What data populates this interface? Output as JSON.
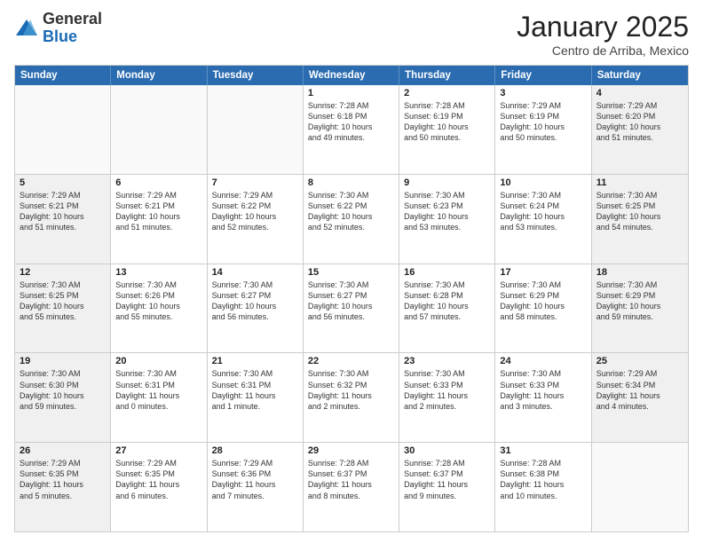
{
  "header": {
    "logo_general": "General",
    "logo_blue": "Blue",
    "month_title": "January 2025",
    "subtitle": "Centro de Arriba, Mexico"
  },
  "days_of_week": [
    "Sunday",
    "Monday",
    "Tuesday",
    "Wednesday",
    "Thursday",
    "Friday",
    "Saturday"
  ],
  "rows": [
    [
      {
        "day": "",
        "empty": true
      },
      {
        "day": "",
        "empty": true
      },
      {
        "day": "",
        "empty": true
      },
      {
        "day": "1",
        "lines": [
          "Sunrise: 7:28 AM",
          "Sunset: 6:18 PM",
          "Daylight: 10 hours",
          "and 49 minutes."
        ]
      },
      {
        "day": "2",
        "lines": [
          "Sunrise: 7:28 AM",
          "Sunset: 6:19 PM",
          "Daylight: 10 hours",
          "and 50 minutes."
        ]
      },
      {
        "day": "3",
        "lines": [
          "Sunrise: 7:29 AM",
          "Sunset: 6:19 PM",
          "Daylight: 10 hours",
          "and 50 minutes."
        ]
      },
      {
        "day": "4",
        "shaded": true,
        "lines": [
          "Sunrise: 7:29 AM",
          "Sunset: 6:20 PM",
          "Daylight: 10 hours",
          "and 51 minutes."
        ]
      }
    ],
    [
      {
        "day": "5",
        "shaded": true,
        "lines": [
          "Sunrise: 7:29 AM",
          "Sunset: 6:21 PM",
          "Daylight: 10 hours",
          "and 51 minutes."
        ]
      },
      {
        "day": "6",
        "lines": [
          "Sunrise: 7:29 AM",
          "Sunset: 6:21 PM",
          "Daylight: 10 hours",
          "and 51 minutes."
        ]
      },
      {
        "day": "7",
        "lines": [
          "Sunrise: 7:29 AM",
          "Sunset: 6:22 PM",
          "Daylight: 10 hours",
          "and 52 minutes."
        ]
      },
      {
        "day": "8",
        "lines": [
          "Sunrise: 7:30 AM",
          "Sunset: 6:22 PM",
          "Daylight: 10 hours",
          "and 52 minutes."
        ]
      },
      {
        "day": "9",
        "lines": [
          "Sunrise: 7:30 AM",
          "Sunset: 6:23 PM",
          "Daylight: 10 hours",
          "and 53 minutes."
        ]
      },
      {
        "day": "10",
        "lines": [
          "Sunrise: 7:30 AM",
          "Sunset: 6:24 PM",
          "Daylight: 10 hours",
          "and 53 minutes."
        ]
      },
      {
        "day": "11",
        "shaded": true,
        "lines": [
          "Sunrise: 7:30 AM",
          "Sunset: 6:25 PM",
          "Daylight: 10 hours",
          "and 54 minutes."
        ]
      }
    ],
    [
      {
        "day": "12",
        "shaded": true,
        "lines": [
          "Sunrise: 7:30 AM",
          "Sunset: 6:25 PM",
          "Daylight: 10 hours",
          "and 55 minutes."
        ]
      },
      {
        "day": "13",
        "lines": [
          "Sunrise: 7:30 AM",
          "Sunset: 6:26 PM",
          "Daylight: 10 hours",
          "and 55 minutes."
        ]
      },
      {
        "day": "14",
        "lines": [
          "Sunrise: 7:30 AM",
          "Sunset: 6:27 PM",
          "Daylight: 10 hours",
          "and 56 minutes."
        ]
      },
      {
        "day": "15",
        "lines": [
          "Sunrise: 7:30 AM",
          "Sunset: 6:27 PM",
          "Daylight: 10 hours",
          "and 56 minutes."
        ]
      },
      {
        "day": "16",
        "lines": [
          "Sunrise: 7:30 AM",
          "Sunset: 6:28 PM",
          "Daylight: 10 hours",
          "and 57 minutes."
        ]
      },
      {
        "day": "17",
        "lines": [
          "Sunrise: 7:30 AM",
          "Sunset: 6:29 PM",
          "Daylight: 10 hours",
          "and 58 minutes."
        ]
      },
      {
        "day": "18",
        "shaded": true,
        "lines": [
          "Sunrise: 7:30 AM",
          "Sunset: 6:29 PM",
          "Daylight: 10 hours",
          "and 59 minutes."
        ]
      }
    ],
    [
      {
        "day": "19",
        "shaded": true,
        "lines": [
          "Sunrise: 7:30 AM",
          "Sunset: 6:30 PM",
          "Daylight: 10 hours",
          "and 59 minutes."
        ]
      },
      {
        "day": "20",
        "lines": [
          "Sunrise: 7:30 AM",
          "Sunset: 6:31 PM",
          "Daylight: 11 hours",
          "and 0 minutes."
        ]
      },
      {
        "day": "21",
        "lines": [
          "Sunrise: 7:30 AM",
          "Sunset: 6:31 PM",
          "Daylight: 11 hours",
          "and 1 minute."
        ]
      },
      {
        "day": "22",
        "lines": [
          "Sunrise: 7:30 AM",
          "Sunset: 6:32 PM",
          "Daylight: 11 hours",
          "and 2 minutes."
        ]
      },
      {
        "day": "23",
        "lines": [
          "Sunrise: 7:30 AM",
          "Sunset: 6:33 PM",
          "Daylight: 11 hours",
          "and 2 minutes."
        ]
      },
      {
        "day": "24",
        "lines": [
          "Sunrise: 7:30 AM",
          "Sunset: 6:33 PM",
          "Daylight: 11 hours",
          "and 3 minutes."
        ]
      },
      {
        "day": "25",
        "shaded": true,
        "lines": [
          "Sunrise: 7:29 AM",
          "Sunset: 6:34 PM",
          "Daylight: 11 hours",
          "and 4 minutes."
        ]
      }
    ],
    [
      {
        "day": "26",
        "shaded": true,
        "lines": [
          "Sunrise: 7:29 AM",
          "Sunset: 6:35 PM",
          "Daylight: 11 hours",
          "and 5 minutes."
        ]
      },
      {
        "day": "27",
        "lines": [
          "Sunrise: 7:29 AM",
          "Sunset: 6:35 PM",
          "Daylight: 11 hours",
          "and 6 minutes."
        ]
      },
      {
        "day": "28",
        "lines": [
          "Sunrise: 7:29 AM",
          "Sunset: 6:36 PM",
          "Daylight: 11 hours",
          "and 7 minutes."
        ]
      },
      {
        "day": "29",
        "lines": [
          "Sunrise: 7:28 AM",
          "Sunset: 6:37 PM",
          "Daylight: 11 hours",
          "and 8 minutes."
        ]
      },
      {
        "day": "30",
        "lines": [
          "Sunrise: 7:28 AM",
          "Sunset: 6:37 PM",
          "Daylight: 11 hours",
          "and 9 minutes."
        ]
      },
      {
        "day": "31",
        "lines": [
          "Sunrise: 7:28 AM",
          "Sunset: 6:38 PM",
          "Daylight: 11 hours",
          "and 10 minutes."
        ]
      },
      {
        "day": "",
        "empty": true
      }
    ]
  ]
}
